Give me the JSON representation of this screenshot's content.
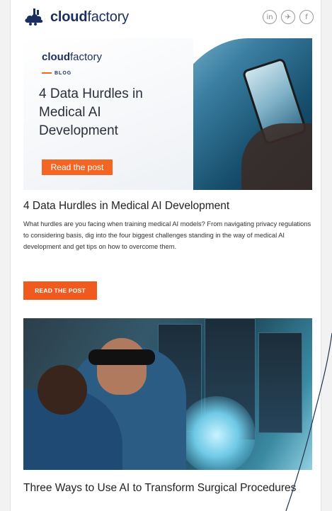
{
  "header": {
    "brand_bold": "cloud",
    "brand_regular": "factory",
    "social": [
      {
        "icon": "linkedin-icon",
        "glyph": "in"
      },
      {
        "icon": "twitter-icon",
        "glyph": "✈"
      },
      {
        "icon": "facebook-icon",
        "glyph": "f"
      }
    ]
  },
  "article1": {
    "banner": {
      "brand_bold": "cloud",
      "brand_regular": "factory",
      "tag": "BLOG",
      "title": "4 Data Hurdles in Medical AI Development",
      "button": "Read the post"
    },
    "title": "4 Data Hurdles in Medical AI Development",
    "body": "What hurdles are you facing when training medical AI models? From navigating privacy regulations to considering basis, dig into the four biggest challenges standing in the way of medical AI development and get tips on how to overcome them.",
    "cta": "READ THE POST"
  },
  "article2": {
    "title": "Three Ways to Use AI to Transform Surgical Procedures"
  },
  "colors": {
    "brand_navy": "#1b2f5f",
    "accent_orange": "#f15a1e"
  }
}
